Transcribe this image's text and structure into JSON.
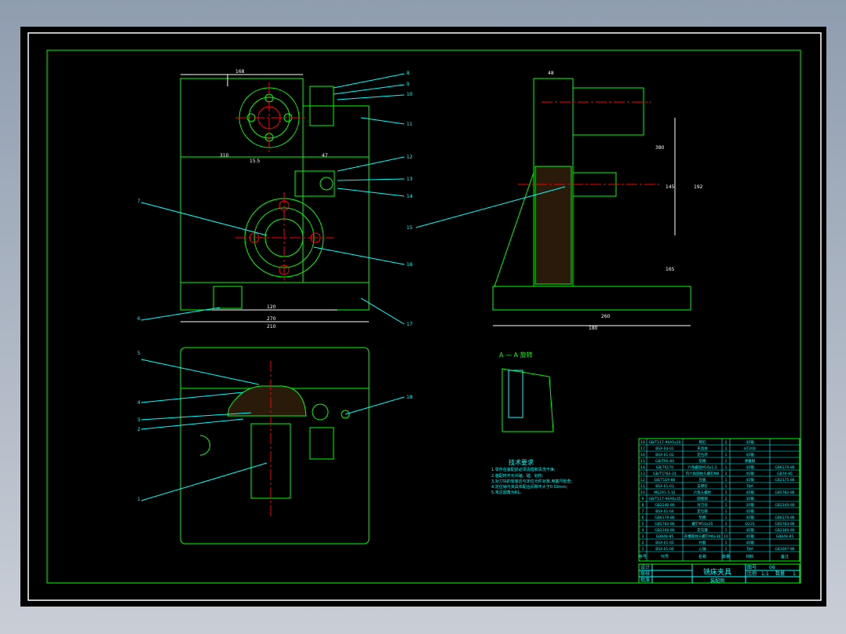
{
  "colors": {
    "frame": "#00ff00",
    "leader": "#00ffff",
    "center": "#ff0000",
    "border": "#ffffff",
    "text": "#00ffff",
    "section": "#00ff00"
  },
  "section_label": "A — A  旋转",
  "tech_req": {
    "title": "技术要求",
    "items": [
      "1.零件在装配前必须清理和清洗干净;",
      "2.装配时不允许磕、碰、划伤;",
      "3.对刀块的安装应与定位元件对准,用塞尺检查;",
      "4.定位销与夹具体配合间隙不大于0.02mm;",
      "5.未注圆角为R1。"
    ]
  },
  "dimensions": [
    "168",
    "120",
    "210",
    "270",
    "310",
    "48",
    "47",
    "15.5",
    "192",
    "145",
    "180",
    "380",
    "165",
    "260"
  ],
  "part_labels": [
    "8",
    "9",
    "10",
    "11",
    "12",
    "13",
    "14",
    "7",
    "15",
    "16",
    "6",
    "17",
    "5",
    "4",
    "3",
    "2",
    "1",
    "18"
  ],
  "bom": {
    "rows": [
      [
        "18",
        "GB/T117-96A5x20",
        "销钉",
        "2",
        "45钢",
        ""
      ],
      [
        "17",
        "BSX-04-01",
        "夹具体",
        "1",
        "HT200",
        ""
      ],
      [
        "16",
        "BSX-01-02",
        "定位环",
        "1",
        "45钢",
        ""
      ],
      [
        "15",
        "GB/T95-84",
        "垫圈",
        "1",
        "弹簧钢",
        ""
      ],
      [
        "14",
        "GB/T6170",
        "六角螺母M16x1.5",
        "1",
        "45钢",
        "GB6170-86"
      ],
      [
        "13",
        "GB/T5783-21",
        "内六角圆柱头螺钉M8",
        "3",
        "45钢",
        "GB70-85"
      ],
      [
        "12",
        "GB/T119-86",
        "压板",
        "1",
        "45钢",
        "GB2175-86"
      ],
      [
        "11",
        "BSX-01-03",
        "支撑钉",
        "1",
        "T8A",
        ""
      ],
      [
        "10",
        "M12X1.5-15",
        "六角头螺栓",
        "3",
        "45钢",
        "GB5782-86"
      ],
      [
        "9",
        "GB/T117-96A6x35",
        "圆锥销",
        "2",
        "35钢",
        ""
      ],
      [
        "8",
        "GB2240-80",
        "对刀块",
        "1",
        "20钢",
        "GB2240-80"
      ],
      [
        "7",
        "BSX-01-04",
        "定位销",
        "1",
        "45钢",
        ""
      ],
      [
        "6",
        "GB6170-86",
        "垫圈",
        "1",
        "45钢",
        "GB6170-86"
      ],
      [
        "5",
        "GB5783-86",
        "螺钉M10x25",
        "3",
        "Q235",
        "GB5783-86"
      ],
      [
        "4",
        "GB2160-80",
        "定向键",
        "1",
        "45钢",
        "GB2160-80"
      ],
      [
        "3",
        "GB848-85",
        "开槽圆柱头螺钉M6x30",
        "10",
        "45钢",
        "GB848-85"
      ],
      [
        "2",
        "BSX-01-05",
        "衬套",
        "1",
        "45钢",
        ""
      ],
      [
        "1",
        "BSX-01-06",
        "心轴",
        "1",
        "T8A",
        "GB3097-86"
      ]
    ],
    "header": [
      "序号",
      "代号",
      "名称",
      "数量",
      "材料",
      "备注"
    ]
  },
  "title_block": {
    "title": "铣床夹具",
    "drawing_no": "图号",
    "drawing_no_val": "06",
    "scale_label": "比例",
    "scale": "1:1",
    "sheet_label": "数量",
    "sheet": "1",
    "design": "设计",
    "check": "审核",
    "approve": "批准",
    "unit": "装配图"
  }
}
